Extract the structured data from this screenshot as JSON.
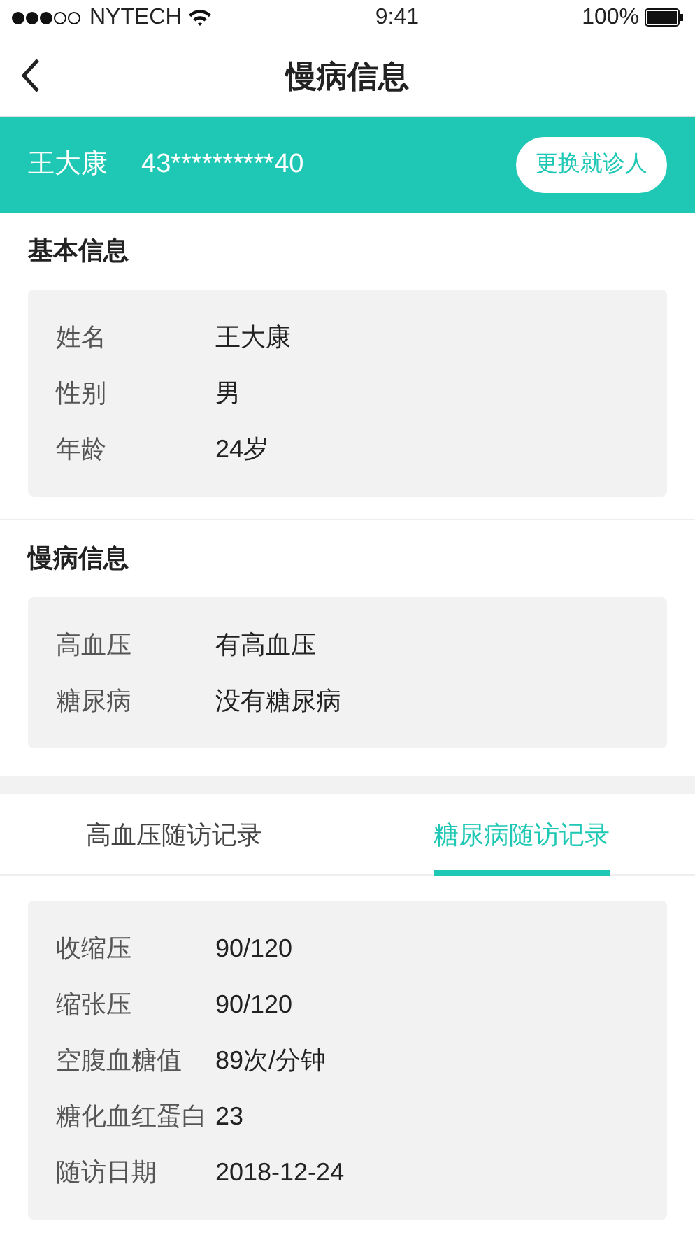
{
  "status_bar": {
    "carrier": "NYTECH",
    "time": "9:41",
    "battery": "100%"
  },
  "nav": {
    "title": "慢病信息"
  },
  "patient": {
    "name": "王大康",
    "id_number": "43**********40",
    "switch_button": "更换就诊人"
  },
  "sections": [
    {
      "title": "基本信息",
      "rows": [
        {
          "label": "姓名",
          "value": "王大康"
        },
        {
          "label": "性别",
          "value": "男"
        },
        {
          "label": "年龄",
          "value": "24岁"
        }
      ]
    },
    {
      "title": "慢病信息",
      "rows": [
        {
          "label": "高血压",
          "value": "有高血压"
        },
        {
          "label": "糖尿病",
          "value": "没有糖尿病"
        }
      ]
    }
  ],
  "tabs": [
    {
      "label": "高血压随访记录",
      "selected": false
    },
    {
      "label": "糖尿病随访记录",
      "selected": true
    }
  ],
  "record": [
    {
      "label": "收缩压",
      "value": "90/120"
    },
    {
      "label": "缩张压",
      "value": "90/120"
    },
    {
      "label": "空腹血糖值",
      "value": "89次/分钟"
    },
    {
      "label": "糖化血红蛋白",
      "value": "23"
    },
    {
      "label": "随访日期",
      "value": "2018-12-24"
    }
  ]
}
